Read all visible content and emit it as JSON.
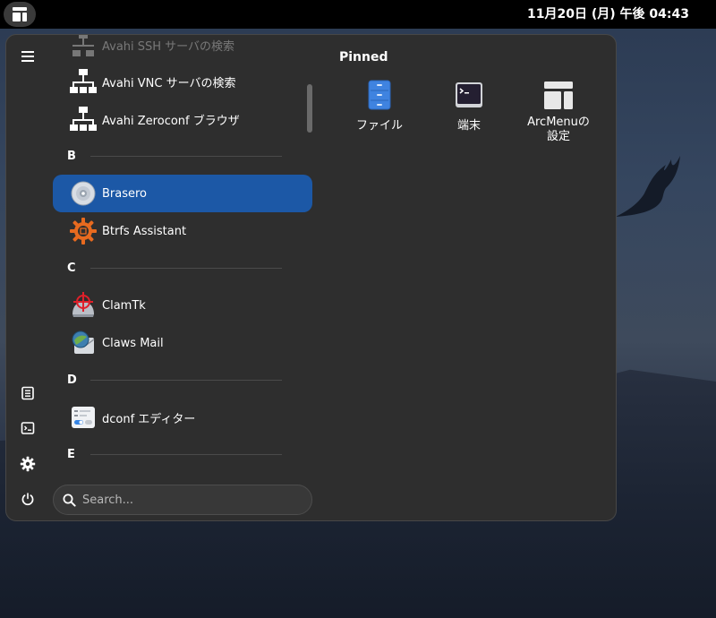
{
  "topbar": {
    "clock": "11月20日 (月) 午後 04:43",
    "activities_icon": "arcmenu-layout-icon"
  },
  "sidebar": {
    "hamburger_icon": "hamburger-menu-icon",
    "buttons": [
      {
        "name": "files",
        "icon": "document-icon"
      },
      {
        "name": "terminal",
        "icon": "terminal-icon"
      },
      {
        "name": "settings",
        "icon": "gear-icon"
      },
      {
        "name": "power",
        "icon": "power-icon"
      }
    ]
  },
  "applist": {
    "partial_top_label": "Avahi SSH サーバの検索",
    "items": [
      {
        "label": "Avahi VNC サーバの検索",
        "icon": "network-icon"
      },
      {
        "label": "Avahi Zeroconf ブラウザ",
        "icon": "network-icon"
      },
      {
        "label": "Brasero",
        "icon": "disc-icon",
        "selected": true
      },
      {
        "label": "Btrfs Assistant",
        "icon": "btrfs-gear-icon"
      },
      {
        "label": "ClamTk",
        "icon": "clamtk-icon"
      },
      {
        "label": "Claws Mail",
        "icon": "claws-mail-icon"
      },
      {
        "label": "dconf エディター",
        "icon": "dconf-editor-icon"
      }
    ],
    "categories": [
      "B",
      "C",
      "D",
      "E"
    ]
  },
  "search": {
    "placeholder": "Search...",
    "value": ""
  },
  "pinned": {
    "title": "Pinned",
    "items": [
      {
        "label": "ファイル",
        "icon": "file-cabinet-icon"
      },
      {
        "label": "端末",
        "icon": "terminal-icon"
      },
      {
        "label": "ArcMenuの\n設定",
        "icon": "arcmenu-layout-icon"
      }
    ]
  },
  "colors": {
    "selected": "#1c58a6",
    "panel": "#2e2e2e",
    "topbar": "#000000"
  }
}
